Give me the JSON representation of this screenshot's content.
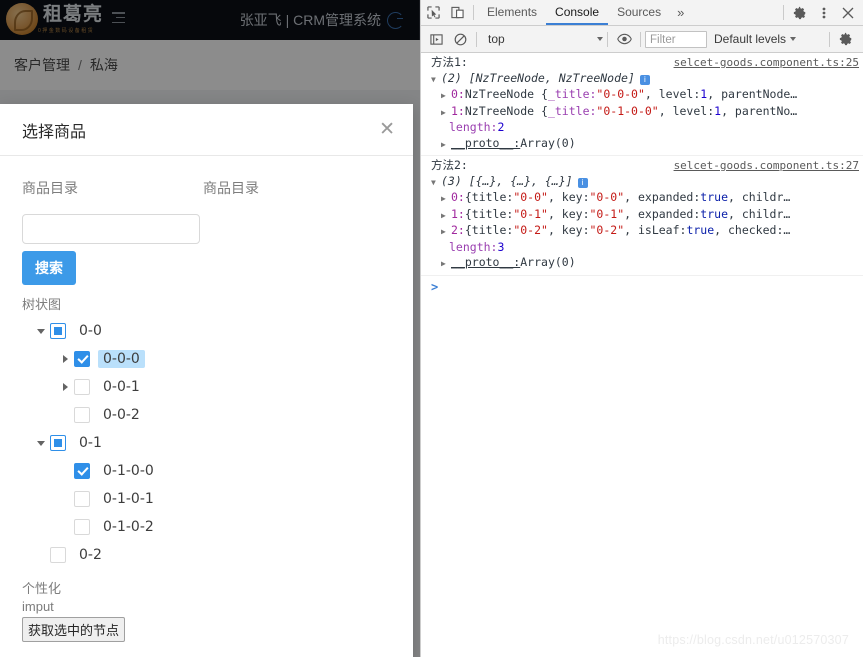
{
  "app": {
    "header": {
      "logo_text": "租葛亮",
      "logo_sub": "0押金数码设备租赁",
      "user_title": "张亚飞 | CRM管理系统",
      "collapse_icon": "menu-fold-icon",
      "refresh_icon": "refresh-circle-icon"
    },
    "breadcrumb": {
      "root": "客户管理",
      "separator": "/",
      "current": "私海"
    }
  },
  "modal": {
    "title": "选择商品",
    "close_label": "✕",
    "label_left": "商品目录",
    "label_right": "商品目录",
    "search_value": "",
    "search_placeholder": "",
    "search_button": "搜索",
    "tree_caption": "树状图",
    "tree": [
      {
        "title": "0-0",
        "indent": 0,
        "expanded": true,
        "has_switcher": true,
        "state": "indeterminate",
        "selected": false
      },
      {
        "title": "0-0-0",
        "indent": 1,
        "expanded": false,
        "has_switcher": true,
        "state": "checked",
        "selected": true
      },
      {
        "title": "0-0-1",
        "indent": 1,
        "expanded": false,
        "has_switcher": true,
        "state": "unchecked",
        "selected": false
      },
      {
        "title": "0-0-2",
        "indent": 1,
        "expanded": false,
        "has_switcher": false,
        "state": "unchecked",
        "selected": false
      },
      {
        "title": "0-1",
        "indent": 0,
        "expanded": true,
        "has_switcher": true,
        "state": "indeterminate",
        "selected": false
      },
      {
        "title": "0-1-0-0",
        "indent": 1,
        "expanded": false,
        "has_switcher": false,
        "state": "checked",
        "selected": false
      },
      {
        "title": "0-1-0-1",
        "indent": 1,
        "expanded": false,
        "has_switcher": false,
        "state": "unchecked",
        "selected": false
      },
      {
        "title": "0-1-0-2",
        "indent": 1,
        "expanded": false,
        "has_switcher": false,
        "state": "unchecked",
        "selected": false
      },
      {
        "title": "0-2",
        "indent": 0,
        "expanded": false,
        "has_switcher": false,
        "state": "unchecked",
        "selected": false
      }
    ],
    "footer_label_1": "个性化",
    "footer_label_2": "imput",
    "get_nodes_button": "获取选中的节点"
  },
  "devtools": {
    "tabs": [
      {
        "label": "Elements",
        "active": false
      },
      {
        "label": "Console",
        "active": true
      },
      {
        "label": "Sources",
        "active": false
      }
    ],
    "more_tabs": "»",
    "icons": {
      "inspect": "inspect-element-icon",
      "device": "device-toolbar-icon",
      "settings": "gear-icon",
      "menu": "kebab-menu-icon",
      "close": "close-icon",
      "sidebar": "console-sidebar-icon",
      "clear": "clear-console-icon",
      "eye": "eye-icon",
      "filter_gear": "console-settings-gear-icon"
    },
    "toolbar": {
      "context": "top",
      "filter_placeholder": "Filter",
      "levels": "Default levels"
    },
    "console": {
      "groups": [
        {
          "label": "方法1:",
          "source": "selcet-goods.component.ts:25",
          "summary_count": "(2)",
          "summary_text": "[NzTreeNode, NzTreeNode]",
          "rows": [
            {
              "index": "0",
              "prefix": "NzTreeNode {",
              "prop": "_title:",
              "str": "\"0-0-0\"",
              "mid": ", level: ",
              "num": "1",
              "tail": ", parentNode…"
            },
            {
              "index": "1",
              "prefix": "NzTreeNode {",
              "prop": "_title:",
              "str": "\"0-1-0-0\"",
              "mid": ", level: ",
              "num": "1",
              "tail": ", parentNo…"
            }
          ],
          "length_label": "length:",
          "length_value": "2",
          "proto_label": "__proto__:",
          "proto_value": "Array(0)"
        },
        {
          "label": "方法2:",
          "source": "selcet-goods.component.ts:27",
          "summary_count": "(3)",
          "summary_text": "[{…}, {…}, {…}]",
          "rows": [
            {
              "index": "0",
              "prefix": "{title: ",
              "str": "\"0-0\"",
              "mid": ", key: ",
              "str2": "\"0-0\"",
              "mid2": ", expanded: ",
              "kw": "true",
              "tail": ", childr…"
            },
            {
              "index": "1",
              "prefix": "{title: ",
              "str": "\"0-1\"",
              "mid": ", key: ",
              "str2": "\"0-1\"",
              "mid2": ", expanded: ",
              "kw": "true",
              "tail": ", childr…"
            },
            {
              "index": "2",
              "prefix": "{title: ",
              "str": "\"0-2\"",
              "mid": ", key: ",
              "str2": "\"0-2\"",
              "mid2": ", isLeaf: ",
              "kw": "true",
              "tail": ", checked:…"
            }
          ],
          "length_label": "length:",
          "length_value": "3",
          "proto_label": "__proto__:",
          "proto_value": "Array(0)"
        }
      ],
      "prompt": ">"
    }
  },
  "watermark": "https://blog.csdn.net/u012570307",
  "colors": {
    "accent_blue": "#3c9ae8",
    "header_bg": "#0b0f16",
    "devtools_bar": "#f3f3f3"
  }
}
